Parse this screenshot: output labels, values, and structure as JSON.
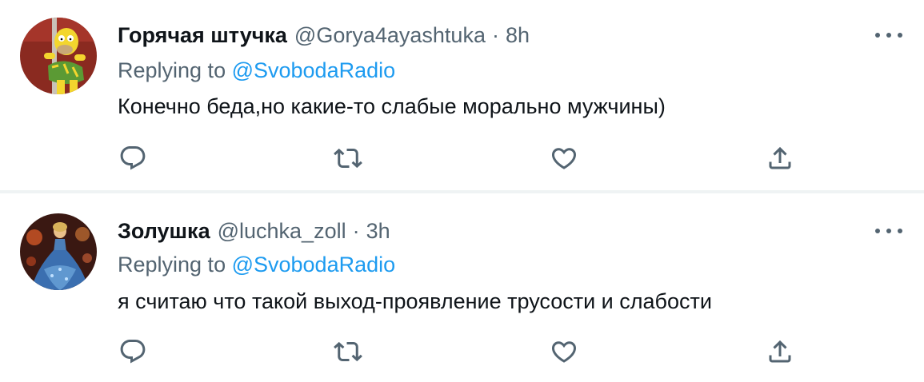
{
  "tweets": [
    {
      "display_name": "Горячая штучка",
      "handle": "@Gorya4ayashtuka",
      "separator": "·",
      "time": "8h",
      "replying_prefix": "Replying to ",
      "replying_to": "@SvobodaRadio",
      "text": "Конечно беда,но какие-то слабые морально мужчины)",
      "avatar_icon": "cartoon-avatar",
      "actions": [
        "reply-icon",
        "retweet-icon",
        "like-icon",
        "share-icon"
      ]
    },
    {
      "display_name": "Золушка",
      "handle": "@luchka_zoll",
      "separator": "·",
      "time": "3h",
      "replying_prefix": "Replying to ",
      "replying_to": "@SvobodaRadio",
      "text": "я считаю что такой выход-проявление трусости и слабости",
      "avatar_icon": "princess-avatar",
      "actions": [
        "reply-icon",
        "retweet-icon",
        "like-icon",
        "share-icon"
      ]
    }
  ],
  "colors": {
    "text_primary": "#0f1419",
    "text_secondary": "#536471",
    "link": "#1d9bf0",
    "divider": "#eff3f4"
  }
}
